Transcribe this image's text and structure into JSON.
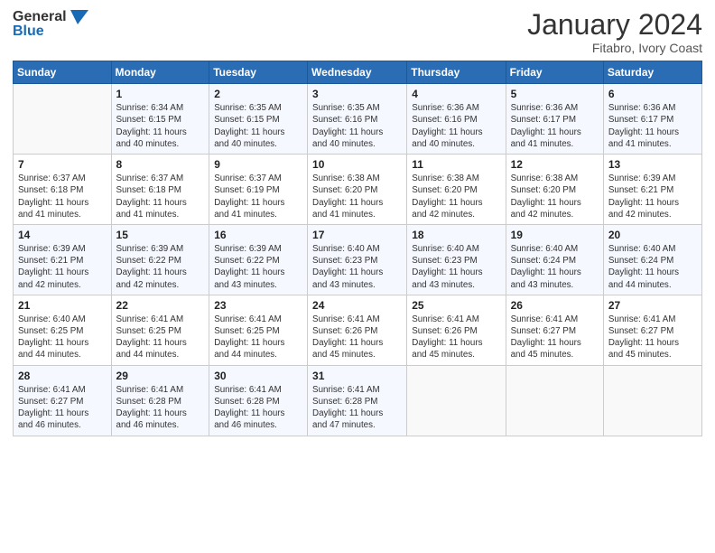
{
  "header": {
    "logo_general": "General",
    "logo_blue": "Blue",
    "month": "January 2024",
    "location": "Fitabro, Ivory Coast"
  },
  "days_of_week": [
    "Sunday",
    "Monday",
    "Tuesday",
    "Wednesday",
    "Thursday",
    "Friday",
    "Saturday"
  ],
  "weeks": [
    [
      {
        "num": "",
        "info": ""
      },
      {
        "num": "1",
        "info": "Sunrise: 6:34 AM\nSunset: 6:15 PM\nDaylight: 11 hours\nand 40 minutes."
      },
      {
        "num": "2",
        "info": "Sunrise: 6:35 AM\nSunset: 6:15 PM\nDaylight: 11 hours\nand 40 minutes."
      },
      {
        "num": "3",
        "info": "Sunrise: 6:35 AM\nSunset: 6:16 PM\nDaylight: 11 hours\nand 40 minutes."
      },
      {
        "num": "4",
        "info": "Sunrise: 6:36 AM\nSunset: 6:16 PM\nDaylight: 11 hours\nand 40 minutes."
      },
      {
        "num": "5",
        "info": "Sunrise: 6:36 AM\nSunset: 6:17 PM\nDaylight: 11 hours\nand 41 minutes."
      },
      {
        "num": "6",
        "info": "Sunrise: 6:36 AM\nSunset: 6:17 PM\nDaylight: 11 hours\nand 41 minutes."
      }
    ],
    [
      {
        "num": "7",
        "info": "Sunrise: 6:37 AM\nSunset: 6:18 PM\nDaylight: 11 hours\nand 41 minutes."
      },
      {
        "num": "8",
        "info": "Sunrise: 6:37 AM\nSunset: 6:18 PM\nDaylight: 11 hours\nand 41 minutes."
      },
      {
        "num": "9",
        "info": "Sunrise: 6:37 AM\nSunset: 6:19 PM\nDaylight: 11 hours\nand 41 minutes."
      },
      {
        "num": "10",
        "info": "Sunrise: 6:38 AM\nSunset: 6:20 PM\nDaylight: 11 hours\nand 41 minutes."
      },
      {
        "num": "11",
        "info": "Sunrise: 6:38 AM\nSunset: 6:20 PM\nDaylight: 11 hours\nand 42 minutes."
      },
      {
        "num": "12",
        "info": "Sunrise: 6:38 AM\nSunset: 6:20 PM\nDaylight: 11 hours\nand 42 minutes."
      },
      {
        "num": "13",
        "info": "Sunrise: 6:39 AM\nSunset: 6:21 PM\nDaylight: 11 hours\nand 42 minutes."
      }
    ],
    [
      {
        "num": "14",
        "info": "Sunrise: 6:39 AM\nSunset: 6:21 PM\nDaylight: 11 hours\nand 42 minutes."
      },
      {
        "num": "15",
        "info": "Sunrise: 6:39 AM\nSunset: 6:22 PM\nDaylight: 11 hours\nand 42 minutes."
      },
      {
        "num": "16",
        "info": "Sunrise: 6:39 AM\nSunset: 6:22 PM\nDaylight: 11 hours\nand 43 minutes."
      },
      {
        "num": "17",
        "info": "Sunrise: 6:40 AM\nSunset: 6:23 PM\nDaylight: 11 hours\nand 43 minutes."
      },
      {
        "num": "18",
        "info": "Sunrise: 6:40 AM\nSunset: 6:23 PM\nDaylight: 11 hours\nand 43 minutes."
      },
      {
        "num": "19",
        "info": "Sunrise: 6:40 AM\nSunset: 6:24 PM\nDaylight: 11 hours\nand 43 minutes."
      },
      {
        "num": "20",
        "info": "Sunrise: 6:40 AM\nSunset: 6:24 PM\nDaylight: 11 hours\nand 44 minutes."
      }
    ],
    [
      {
        "num": "21",
        "info": "Sunrise: 6:40 AM\nSunset: 6:25 PM\nDaylight: 11 hours\nand 44 minutes."
      },
      {
        "num": "22",
        "info": "Sunrise: 6:41 AM\nSunset: 6:25 PM\nDaylight: 11 hours\nand 44 minutes."
      },
      {
        "num": "23",
        "info": "Sunrise: 6:41 AM\nSunset: 6:25 PM\nDaylight: 11 hours\nand 44 minutes."
      },
      {
        "num": "24",
        "info": "Sunrise: 6:41 AM\nSunset: 6:26 PM\nDaylight: 11 hours\nand 45 minutes."
      },
      {
        "num": "25",
        "info": "Sunrise: 6:41 AM\nSunset: 6:26 PM\nDaylight: 11 hours\nand 45 minutes."
      },
      {
        "num": "26",
        "info": "Sunrise: 6:41 AM\nSunset: 6:27 PM\nDaylight: 11 hours\nand 45 minutes."
      },
      {
        "num": "27",
        "info": "Sunrise: 6:41 AM\nSunset: 6:27 PM\nDaylight: 11 hours\nand 45 minutes."
      }
    ],
    [
      {
        "num": "28",
        "info": "Sunrise: 6:41 AM\nSunset: 6:27 PM\nDaylight: 11 hours\nand 46 minutes."
      },
      {
        "num": "29",
        "info": "Sunrise: 6:41 AM\nSunset: 6:28 PM\nDaylight: 11 hours\nand 46 minutes."
      },
      {
        "num": "30",
        "info": "Sunrise: 6:41 AM\nSunset: 6:28 PM\nDaylight: 11 hours\nand 46 minutes."
      },
      {
        "num": "31",
        "info": "Sunrise: 6:41 AM\nSunset: 6:28 PM\nDaylight: 11 hours\nand 47 minutes."
      },
      {
        "num": "",
        "info": ""
      },
      {
        "num": "",
        "info": ""
      },
      {
        "num": "",
        "info": ""
      }
    ]
  ]
}
